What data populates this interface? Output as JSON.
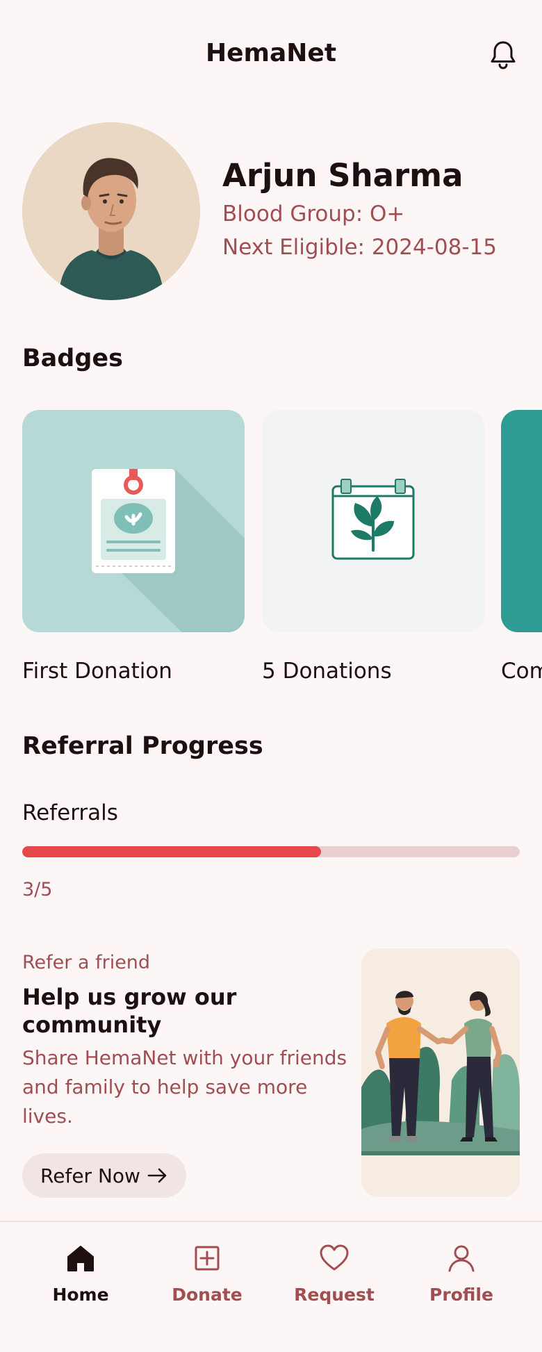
{
  "header": {
    "title": "HemaNet",
    "notifications_icon": "bell-icon"
  },
  "profile": {
    "name": "Arjun Sharma",
    "blood_group": "Blood Group: O+",
    "next_eligible": "Next Eligible: 2024-08-15"
  },
  "badges": {
    "title": "Badges",
    "items": [
      {
        "label": "First Donation",
        "icon": "blood-bag-icon",
        "bg": "#b7d9d5"
      },
      {
        "label": "5 Donations",
        "icon": "calendar-leaf-icon",
        "bg": "#f2f4f3"
      },
      {
        "label": "Com",
        "icon": "",
        "bg": "#2e9c92"
      }
    ]
  },
  "referral": {
    "title": "Referral Progress",
    "label": "Referrals",
    "progress": 0.6,
    "count": "3/5"
  },
  "refer_card": {
    "eyebrow": "Refer a friend",
    "title": "Help us grow our community",
    "body": "Share HemaNet with your friends and family to help save more lives.",
    "button": "Refer Now",
    "illustration": "handshake-illustration"
  },
  "nav": {
    "items": [
      {
        "label": "Home",
        "icon": "home-icon",
        "active": true
      },
      {
        "label": "Donate",
        "icon": "plus-square-icon",
        "active": false
      },
      {
        "label": "Request",
        "icon": "heart-icon",
        "active": false
      },
      {
        "label": "Profile",
        "icon": "user-icon",
        "active": false
      }
    ]
  },
  "colors": {
    "accent": "#e8484a",
    "muted_text": "#a14e52",
    "background": "#fcf7f6"
  }
}
